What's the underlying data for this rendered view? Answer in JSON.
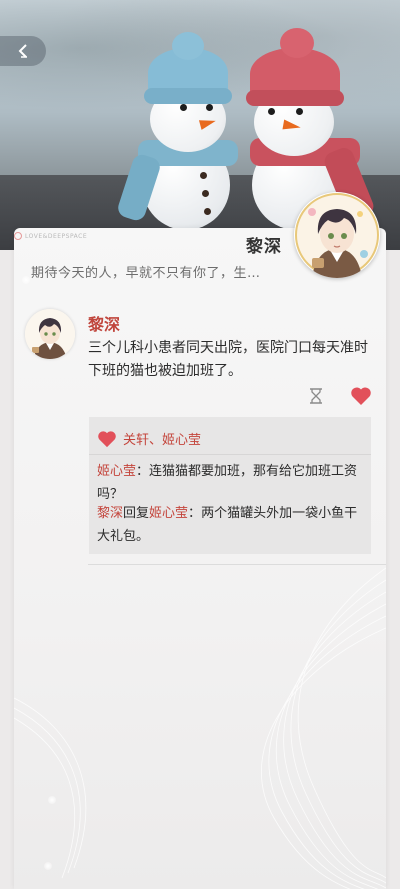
{
  "profile": {
    "name": "黎深",
    "signature": "期待今天的人，早就不只有你了，生…"
  },
  "brand": {
    "logo_text": "LOVE&DEEPSPACE"
  },
  "post": {
    "author": "黎深",
    "text": "三个儿科小患者同天出院，医院门口每天准时下班的猫也被迫加班了。"
  },
  "likes": {
    "names": "关轩、姬心莹"
  },
  "comments": [
    {
      "user": "姬心莹",
      "sep": "：",
      "text": "连猫猫都要加班，那有给它加班工资吗？"
    },
    {
      "user": "黎深",
      "reply_word": "回复",
      "reply_to": "姬心莹",
      "sep": "：",
      "text": "两个猫罐头外加一袋小鱼干大礼包。"
    }
  ],
  "colors": {
    "accent_red": "#c4453c",
    "heart": "#e2505a"
  },
  "icons": {
    "back": "chevron-left-icon",
    "hourglass": "hourglass-icon",
    "like": "heart-icon"
  }
}
